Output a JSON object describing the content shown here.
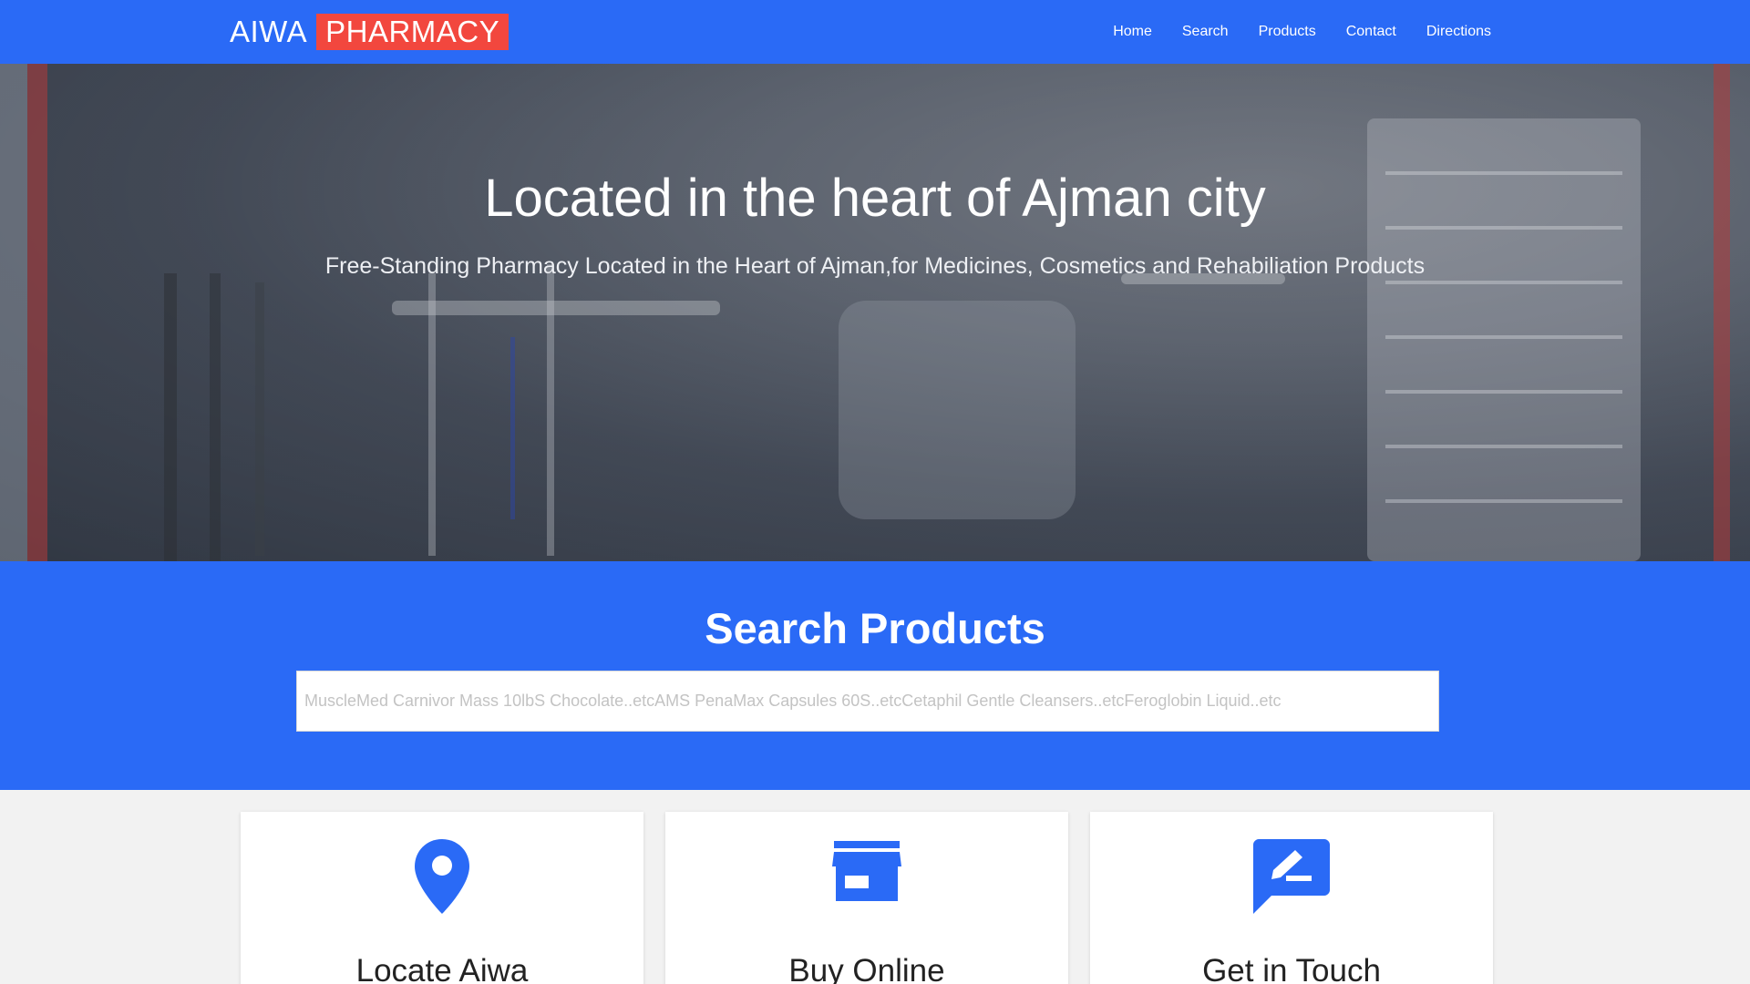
{
  "brand": {
    "part1": "AIWA",
    "part2": "PHARMACY",
    "accent": "#f2473e"
  },
  "nav": {
    "items": [
      {
        "label": "Home"
      },
      {
        "label": "Search"
      },
      {
        "label": "Products"
      },
      {
        "label": "Contact"
      },
      {
        "label": "Directions"
      }
    ],
    "background": "#2a6af6"
  },
  "hero": {
    "title": "Located in the heart of Ajman city",
    "subtitle": "Free-Standing Pharmacy Located in the Heart of Ajman,for Medicines, Cosmetics and Rehabiliation Products"
  },
  "search": {
    "title": "Search Products",
    "placeholder": "MuscleMed Carnivor Mass 10lbS Chocolate..etcAMS PenaMax Capsules 60S..etcCetaphil Gentle Cleansers..etcFeroglobin Liquid..etc"
  },
  "cards": [
    {
      "title": "Locate Aiwa",
      "icon": "map-pin-icon"
    },
    {
      "title": "Buy Online",
      "icon": "store-icon"
    },
    {
      "title": "Get in Touch",
      "icon": "message-edit-icon"
    }
  ],
  "colors": {
    "primary": "#2a6af6",
    "icon": "#2a6af6"
  }
}
